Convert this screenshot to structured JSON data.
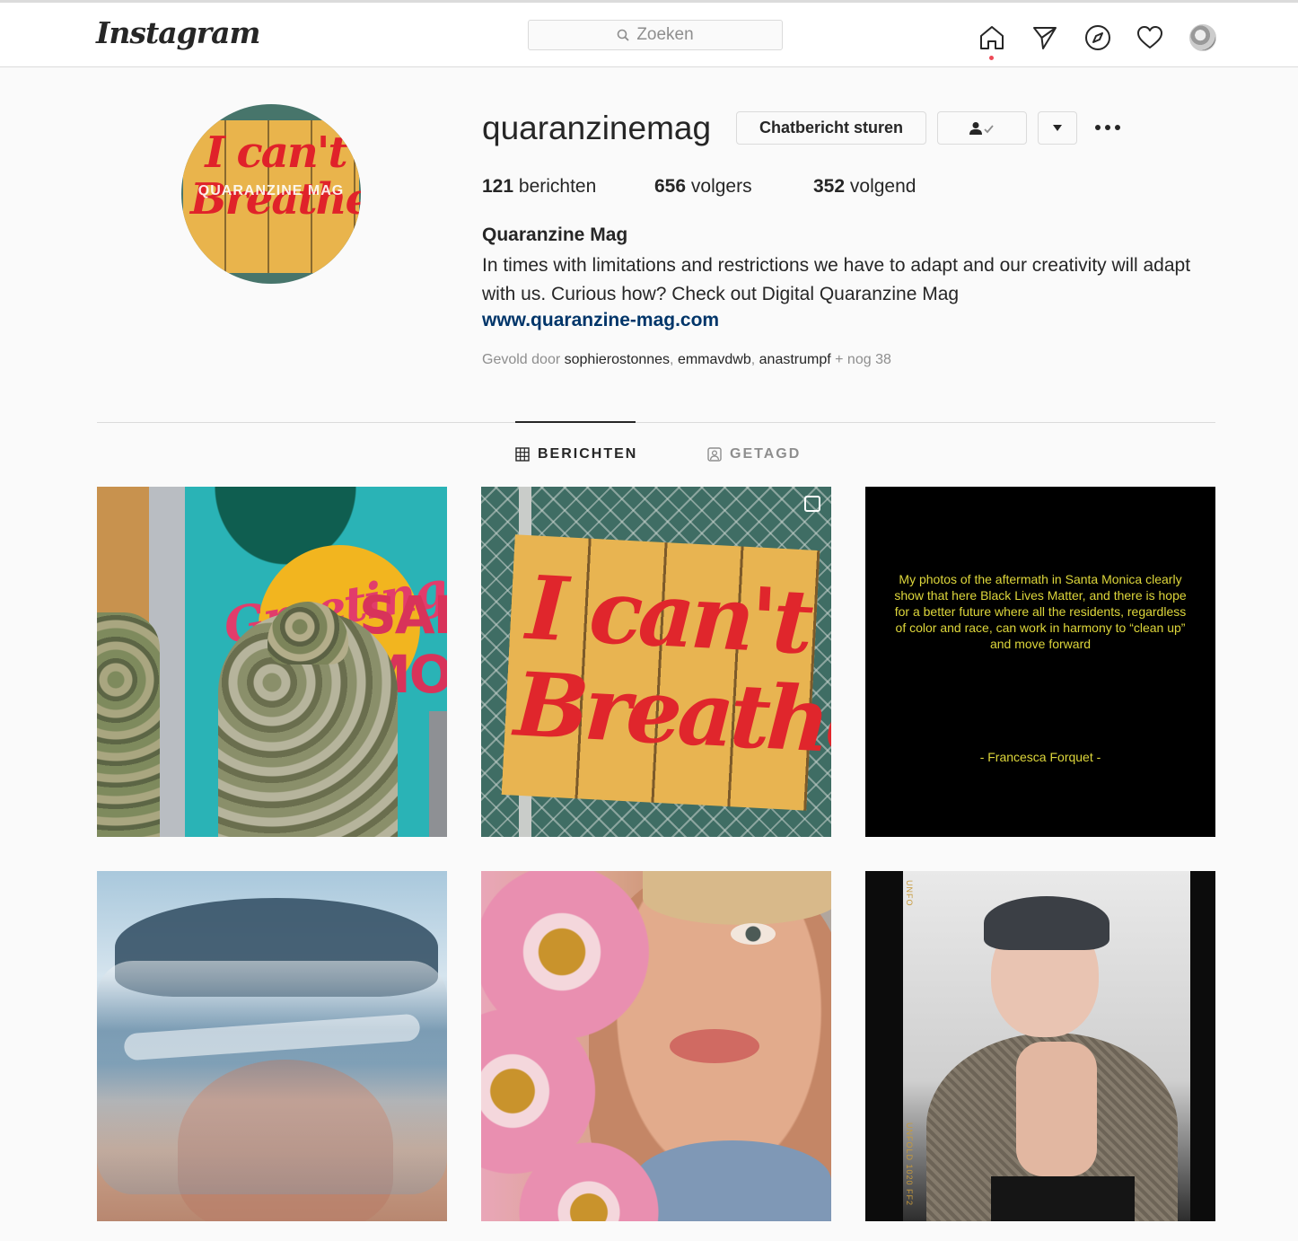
{
  "nav": {
    "logo": "Instagram",
    "search_placeholder": "Zoeken"
  },
  "profile": {
    "username": "quaranzinemag",
    "message_button": "Chatbericht sturen",
    "stats": {
      "posts_count": "121",
      "posts_label": "berichten",
      "followers_count": "656",
      "followers_label": "volgers",
      "following_count": "352",
      "following_label": "volgend"
    },
    "full_name": "Quaranzine Mag",
    "bio": "In times with limitations and restrictions we have to adapt and our creativity will adapt with us. Curious how? Check out Digital Quaranzine Mag",
    "website": "www.quaranzine-mag.com",
    "followed_by": {
      "prefix": "Gevold door",
      "users": [
        "sophierostonnes",
        "emmavdwb",
        "anastrumpf"
      ],
      "suffix": "+ nog 38"
    },
    "avatar_text": {
      "line1": "I can't",
      "line2": "Breathe!",
      "watermark": "QUARANZINE MAG"
    }
  },
  "tabs": {
    "posts": "BERICHTEN",
    "tagged": "GETAGD"
  },
  "posts": {
    "p1": {
      "greeting": "Greetings",
      "san": "SAN",
      "mon": "MON"
    },
    "p2": {
      "line1": "I can't",
      "line2": "Breathe!"
    },
    "p3": {
      "quote": "My photos of the aftermath in Santa Monica clearly show that here Black Lives Matter, and there is hope for a better future where all the residents, regardless of color and race, can work in harmony to “clean up” and move forward",
      "author": "- Francesca Forquet -"
    },
    "p6": {
      "film_top": "UNFO",
      "film_bottom": "UNFOLD 1020 FF2"
    }
  },
  "colors": {
    "accent_link": "#003569",
    "notification_dot": "#ed4956",
    "quote_text": "#ddd63b"
  }
}
